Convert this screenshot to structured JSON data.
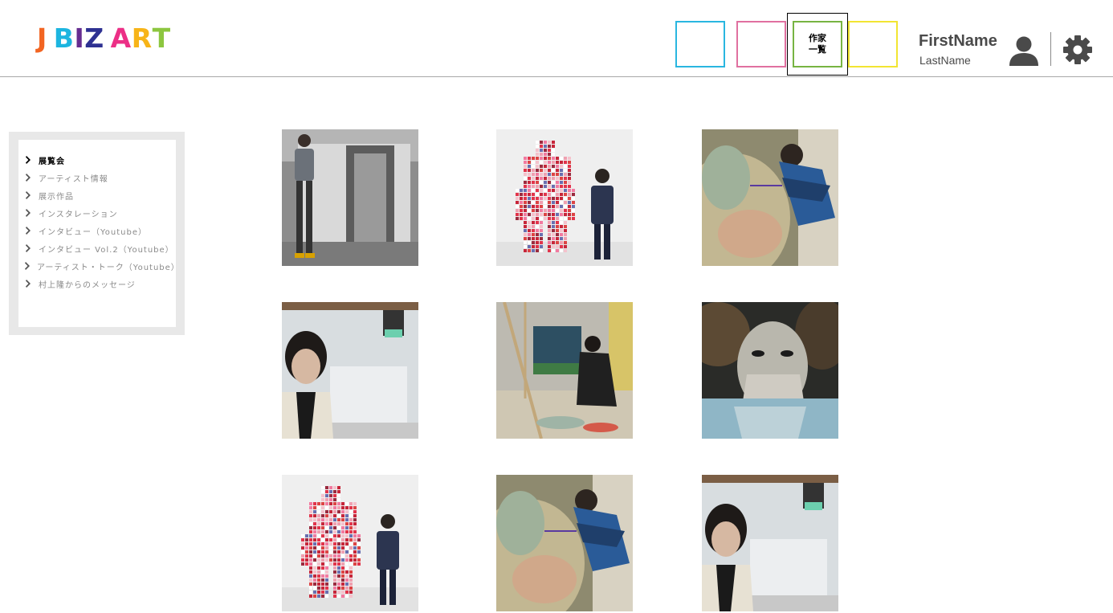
{
  "brand": {
    "logo_letters": [
      {
        "ch": "J",
        "color": "#f26522"
      },
      {
        "ch": " ",
        "color": "#000000"
      },
      {
        "ch": "B",
        "color": "#1cb5e0"
      },
      {
        "ch": "I",
        "color": "#662d91"
      },
      {
        "ch": "Z",
        "color": "#2e3192"
      },
      {
        "ch": " ",
        "color": "#000000"
      },
      {
        "ch": "A",
        "color": "#ec2f86"
      },
      {
        "ch": "R",
        "color": "#f7b418"
      },
      {
        "ch": "T",
        "color": "#8cc63f"
      }
    ]
  },
  "nav": {
    "boxes": [
      {
        "label": "",
        "color": "#29b6e0"
      },
      {
        "label": "",
        "color": "#e070a0"
      },
      {
        "label": "作家\n一覧",
        "color": "#77b442"
      },
      {
        "label": "",
        "color": "#f2e532"
      }
    ]
  },
  "user": {
    "first_name": "FirstName",
    "last_name": "LastName"
  },
  "sidebar": {
    "items": [
      {
        "label": "展覧会",
        "active": true
      },
      {
        "label": "アーティスト情報",
        "active": false
      },
      {
        "label": "展示作品",
        "active": false
      },
      {
        "label": "インスタレーション",
        "active": false
      },
      {
        "label": "インタビュー（Youtube）",
        "active": false
      },
      {
        "label": "インタビュー Vol.2（Youtube）",
        "active": false
      },
      {
        "label": "アーティスト・トーク（Youtube）",
        "active": false
      },
      {
        "label": "村上隆からのメッセージ",
        "active": false
      }
    ]
  },
  "gallery": {
    "tiles": [
      {
        "scene": "standing-canvas"
      },
      {
        "scene": "pixel-warrior"
      },
      {
        "scene": "painting-close"
      },
      {
        "scene": "portrait-studio"
      },
      {
        "scene": "studio-floor"
      },
      {
        "scene": "face-painting"
      },
      {
        "scene": "pixel-warrior"
      },
      {
        "scene": "painting-close"
      },
      {
        "scene": "portrait-studio"
      }
    ]
  }
}
